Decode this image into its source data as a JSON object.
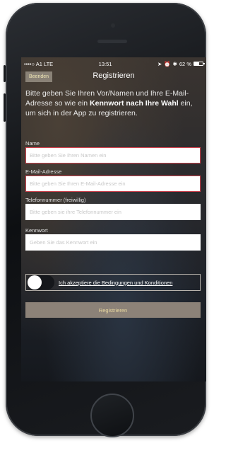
{
  "status": {
    "carrier": "••••○ A1  LTE",
    "time": "13:51",
    "battery_percent": "62 %",
    "battery_level": 0.62
  },
  "nav": {
    "cancel_label": "Beenden",
    "title": "Registrieren"
  },
  "intro": {
    "text_before": "Bitte geben Sie Ihren Vor/Namen und Ihre E-Mail-Adresse so wie ein ",
    "bold": "Kennwort nach Ihre Wahl",
    "text_after": " ein, um sich in der App zu registrieren."
  },
  "form": {
    "name": {
      "label": "Name",
      "placeholder": "Bitte geben Sie Ihren Namen ein",
      "value": ""
    },
    "email": {
      "label": "E-Mail-Adresse",
      "placeholder": "Bitte geben Sie Ihren E-Mail-Adresse ein",
      "value": ""
    },
    "phone": {
      "label": "Telefonnummer (freiwillig)",
      "placeholder": "Bitte geben sie ihre Telefonnummer ein",
      "value": ""
    },
    "password": {
      "label": "Kennwort",
      "placeholder": "Geben Sie das Kennwort ein",
      "value": ""
    }
  },
  "terms": {
    "label": "Ich akzeptiere die Bedingungen und Konditionen",
    "accepted": false
  },
  "register_label": "Registrieren",
  "colors": {
    "invalid_border": "#d2434f",
    "button_bg": "#8c8278",
    "button_text": "#ead9a0"
  }
}
